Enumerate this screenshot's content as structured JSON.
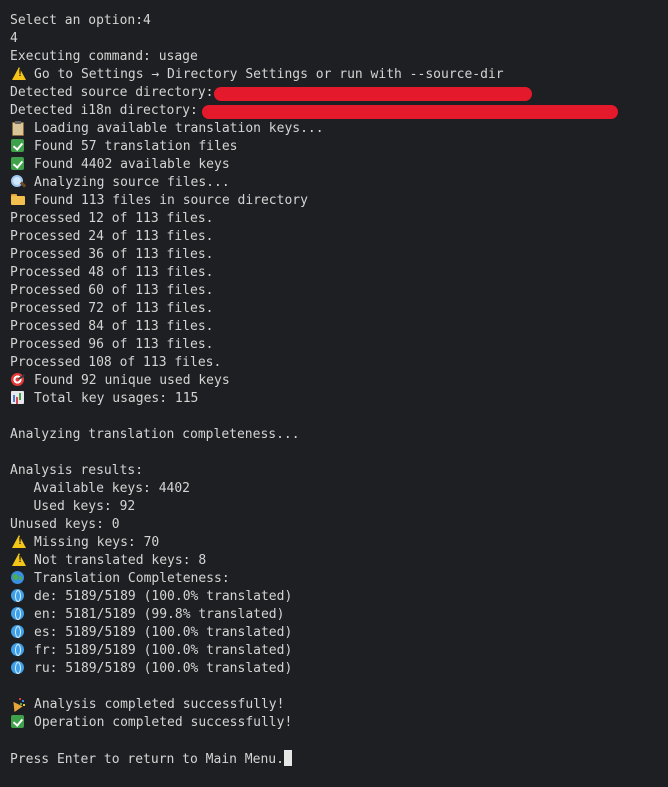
{
  "terminal": {
    "lines": {
      "select_prompt": "Select an option:4",
      "input_value": "4",
      "executing": "Executing command: usage",
      "settings_hint": "Go to Settings → Directory Settings or run with --source-dir",
      "source_dir": "Detected source directory:",
      "i18n_dir": "Detected i18n directory:",
      "loading_keys": "Loading available translation keys...",
      "found_files": "Found 57 translation files",
      "found_keys": "Found 4402 available keys",
      "analyzing_source": "Analyzing source files...",
      "found_source_files": "Found 113 files in source directory",
      "processed": [
        "Processed 12 of 113 files.",
        "Processed 24 of 113 files.",
        "Processed 36 of 113 files.",
        "Processed 48 of 113 files.",
        "Processed 60 of 113 files.",
        "Processed 72 of 113 files.",
        "Processed 84 of 113 files.",
        "Processed 96 of 113 files.",
        "Processed 108 of 113 files."
      ],
      "unique_used_keys": "Found 92 unique used keys",
      "total_usages": "Total key usages: 115",
      "analyzing_completeness": "Analyzing translation completeness...",
      "results_header": "Analysis results:",
      "available_keys": "   Available keys: 4402",
      "used_keys": "   Used keys: 92",
      "unused_keys": "Unused keys: 0",
      "missing_keys": "Missing keys: 70",
      "not_translated": "Not translated keys: 8",
      "completeness_header": "Translation Completeness:",
      "languages": [
        "de: 5189/5189 (100.0% translated)",
        "en: 5181/5189 (99.8% translated)",
        "es: 5189/5189 (100.0% translated)",
        "fr: 5189/5189 (100.0% translated)",
        "ru: 5189/5189 (100.0% translated)"
      ],
      "analysis_done": "Analysis completed successfully!",
      "operation_done": "Operation completed successfully!",
      "press_enter": "Press Enter to return to Main Menu."
    },
    "icons": {
      "warning": "warning-icon",
      "check": "check-mark-icon",
      "clipboard": "clipboard-icon",
      "magnifier": "magnifier-icon",
      "folder": "folder-icon",
      "target": "target-icon",
      "barchart": "bar-chart-icon",
      "globe": "globe-icon",
      "meridians": "globe-meridians-icon",
      "party": "party-popper-icon"
    },
    "colors": {
      "background": "#1e1f22",
      "text": "#d4d4d4",
      "redaction": "#e5192c"
    }
  }
}
